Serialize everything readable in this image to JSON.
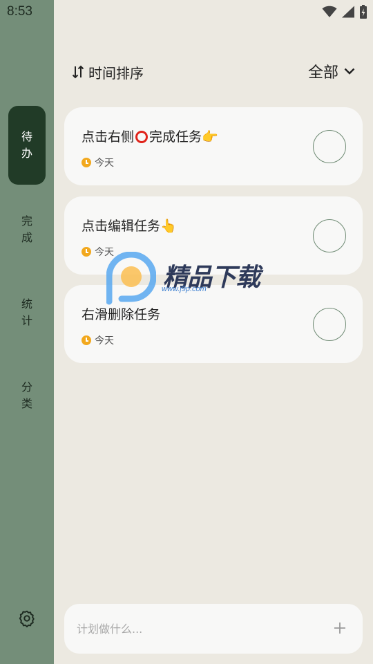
{
  "status_bar": {
    "time": "8:53"
  },
  "sidebar": {
    "items": [
      {
        "label": [
          "待",
          "办"
        ],
        "active": true
      },
      {
        "label": [
          "完",
          "成"
        ],
        "active": false
      },
      {
        "label": [
          "统",
          "计"
        ],
        "active": false
      },
      {
        "label": [
          "分",
          "类"
        ],
        "active": false
      }
    ],
    "settings_icon": "gear-icon"
  },
  "header": {
    "sort_label": "时间排序",
    "filter_label": "全部"
  },
  "tasks": [
    {
      "title_before": "点击右侧",
      "title_after": "完成任务👉",
      "due": "今天"
    },
    {
      "title": "点击编辑任务👆",
      "due": "今天"
    },
    {
      "title": "右滑删除任务",
      "due": "今天"
    }
  ],
  "watermark": {
    "text": "精品下载",
    "url": "www.j9p.com"
  },
  "composer": {
    "placeholder": "计划做什么..."
  },
  "colors": {
    "sidebar": "#748E79",
    "sidebar_active": "#213B27",
    "background": "#ECE9E1",
    "card": "#F8F8F7",
    "checkbox": "#6E8A73",
    "clock": "#F2A81D"
  }
}
